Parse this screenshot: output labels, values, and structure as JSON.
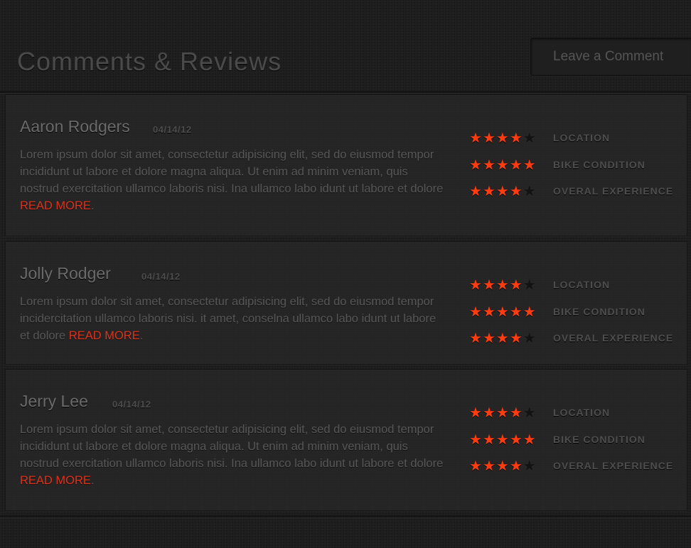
{
  "header": {
    "title": "Comments & Reviews",
    "leave_comment_label": "Leave a Comment"
  },
  "colors": {
    "accent": "#ff3b10",
    "read_more": "#e0321b",
    "background": "#1e1e1e"
  },
  "reviews": [
    {
      "name": "Aaron Rodgers",
      "date": "04/14/12",
      "body": "Lorem ipsum dolor sit amet, consectetur adipisicing elit, sed do eiusmod tempor incididunt ut labore et dolore magna aliqua. Ut enim ad minim veniam, quis nostrud exercitation ullamco laboris nisi. Ina ullamco labo idunt ut labore et dolore ",
      "read_more": "READ MORE",
      "ratings": [
        {
          "label": "LOCATION",
          "stars": 4,
          "max": 5
        },
        {
          "label": "BIKE CONDITION",
          "stars": 5,
          "max": 5
        },
        {
          "label": "OVERAL EXPERIENCE",
          "stars": 4,
          "max": 5
        }
      ]
    },
    {
      "name": "Jolly Rodger",
      "date": "04/14/12",
      "body": "Lorem ipsum dolor sit amet, consectetur adipisicing elit, sed do eiusmod tempor incidercitation ullamco laboris nisi. it amet, conselna ullamco labo idunt ut labore et dolore ",
      "read_more": "READ MORE",
      "ratings": [
        {
          "label": "LOCATION",
          "stars": 4,
          "max": 5
        },
        {
          "label": "BIKE CONDITION",
          "stars": 5,
          "max": 5
        },
        {
          "label": "OVERAL EXPERIENCE",
          "stars": 4,
          "max": 5
        }
      ]
    },
    {
      "name": "Jerry Lee",
      "date": "04/14/12",
      "body": "Lorem ipsum dolor sit amet, consectetur adipisicing elit, sed do eiusmod tempor incididunt ut labore et dolore magna aliqua. Ut enim ad minim veniam, quis nostrud exercitation ullamco laboris nisi. Ina ullamco labo idunt ut labore et dolore ",
      "read_more": "READ MORE",
      "ratings": [
        {
          "label": "LOCATION",
          "stars": 4,
          "max": 5
        },
        {
          "label": "BIKE CONDITION",
          "stars": 5,
          "max": 5
        },
        {
          "label": "OVERAL EXPERIENCE",
          "stars": 4,
          "max": 5
        }
      ]
    }
  ]
}
